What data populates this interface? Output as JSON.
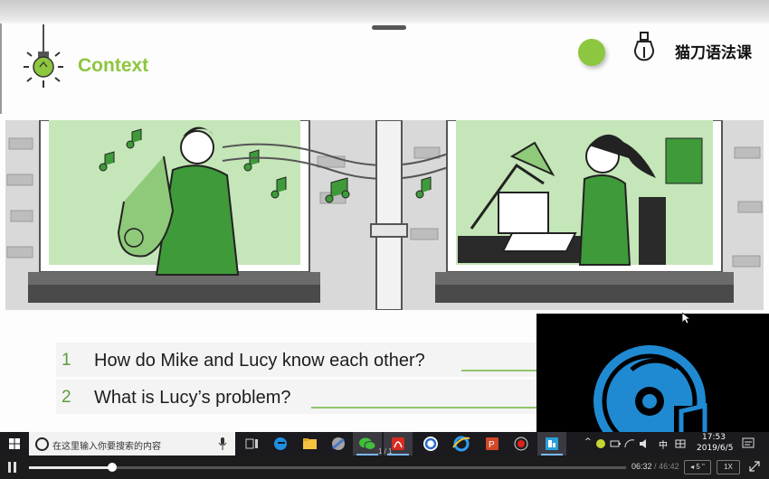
{
  "slide": {
    "title": "Context",
    "brand": "猫刀语法课",
    "accent_color": "#8dc63f",
    "illustration": {
      "left_panel": "man-playing-saxophone",
      "right_panel": "woman-at-laptop-covering-ears"
    },
    "questions": [
      {
        "number": "1",
        "text": "How do Mike and Lucy know each other?"
      },
      {
        "number": "2",
        "text": "What is Lucy’s problem?"
      }
    ]
  },
  "video_overlay": {
    "icon": "media-player-disc-icon"
  },
  "taskbar": {
    "search_placeholder": "在这里输入你要搜索的内容",
    "apps": [
      "task-view-icon",
      "edge-icon",
      "file-explorer-icon",
      "browser-icon",
      "wechat-icon",
      "acrobat-icon",
      "app-c-icon",
      "ie-icon",
      "powerpoint-icon",
      "recorder-icon",
      "media-app-icon"
    ],
    "tray": {
      "ime": "中",
      "time": "17:53",
      "date": "2019/6/5"
    }
  },
  "player": {
    "page_indicator": "1 / 1",
    "current_time": "06:32",
    "separator": "/",
    "total_time": "46:42",
    "progress": 0.14,
    "rewind_label": "◂ 5 \"",
    "speed_label": "1X"
  }
}
